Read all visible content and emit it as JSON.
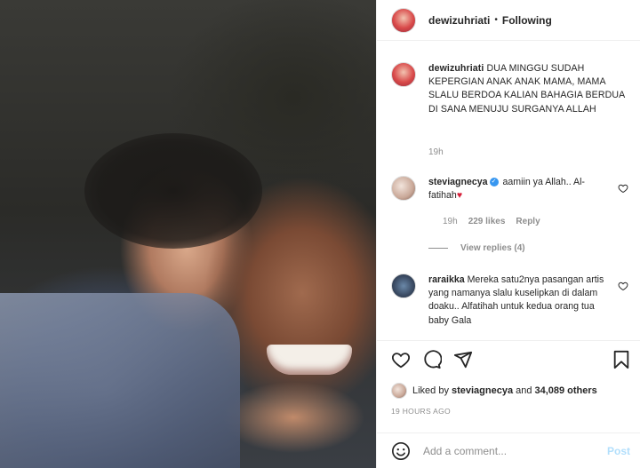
{
  "post": {
    "username": "dewizuhriati",
    "separator": "•",
    "follow_status": "Following"
  },
  "caption": {
    "username": "dewizuhriati",
    "text": "DUA MINGGU SUDAH KEPERGIAN ANAK ANAK MAMA, MAMA SLALU BERDOA KALIAN BAHAGIA BERDUA DI SANA MENUJU SURGANYA ALLAH",
    "time": "19h"
  },
  "comments": [
    {
      "username": "steviagnecya",
      "verified": true,
      "text": "aamiin ya Allah.. Al-fatihah",
      "emoji": "♥",
      "time": "19h",
      "likes": "229 likes",
      "reply_label": "Reply",
      "view_replies": "View replies (4)"
    },
    {
      "username": "raraikka",
      "text": "Mereka satu2nya pasangan artis yang namanya slalu kuselipkan di dalam doaku.. Alfatihah untuk kedua orang tua baby Gala"
    }
  ],
  "likes": {
    "prefix": "Liked by",
    "user": "steviagnecya",
    "middle": "and",
    "count": "34,089 others"
  },
  "timestamp": "19 HOURS AGO",
  "add_comment": {
    "placeholder": "Add a comment...",
    "post_label": "Post"
  },
  "icons": [
    "heart-icon",
    "comment-icon",
    "share-icon",
    "bookmark-icon",
    "smiley-icon",
    "verified-icon"
  ],
  "colors": {
    "text": "#262626",
    "secondary": "#8e8e8e",
    "verified": "#3897f0",
    "post_disabled": "#b2dffc",
    "heart_emoji": "#d6203a"
  }
}
